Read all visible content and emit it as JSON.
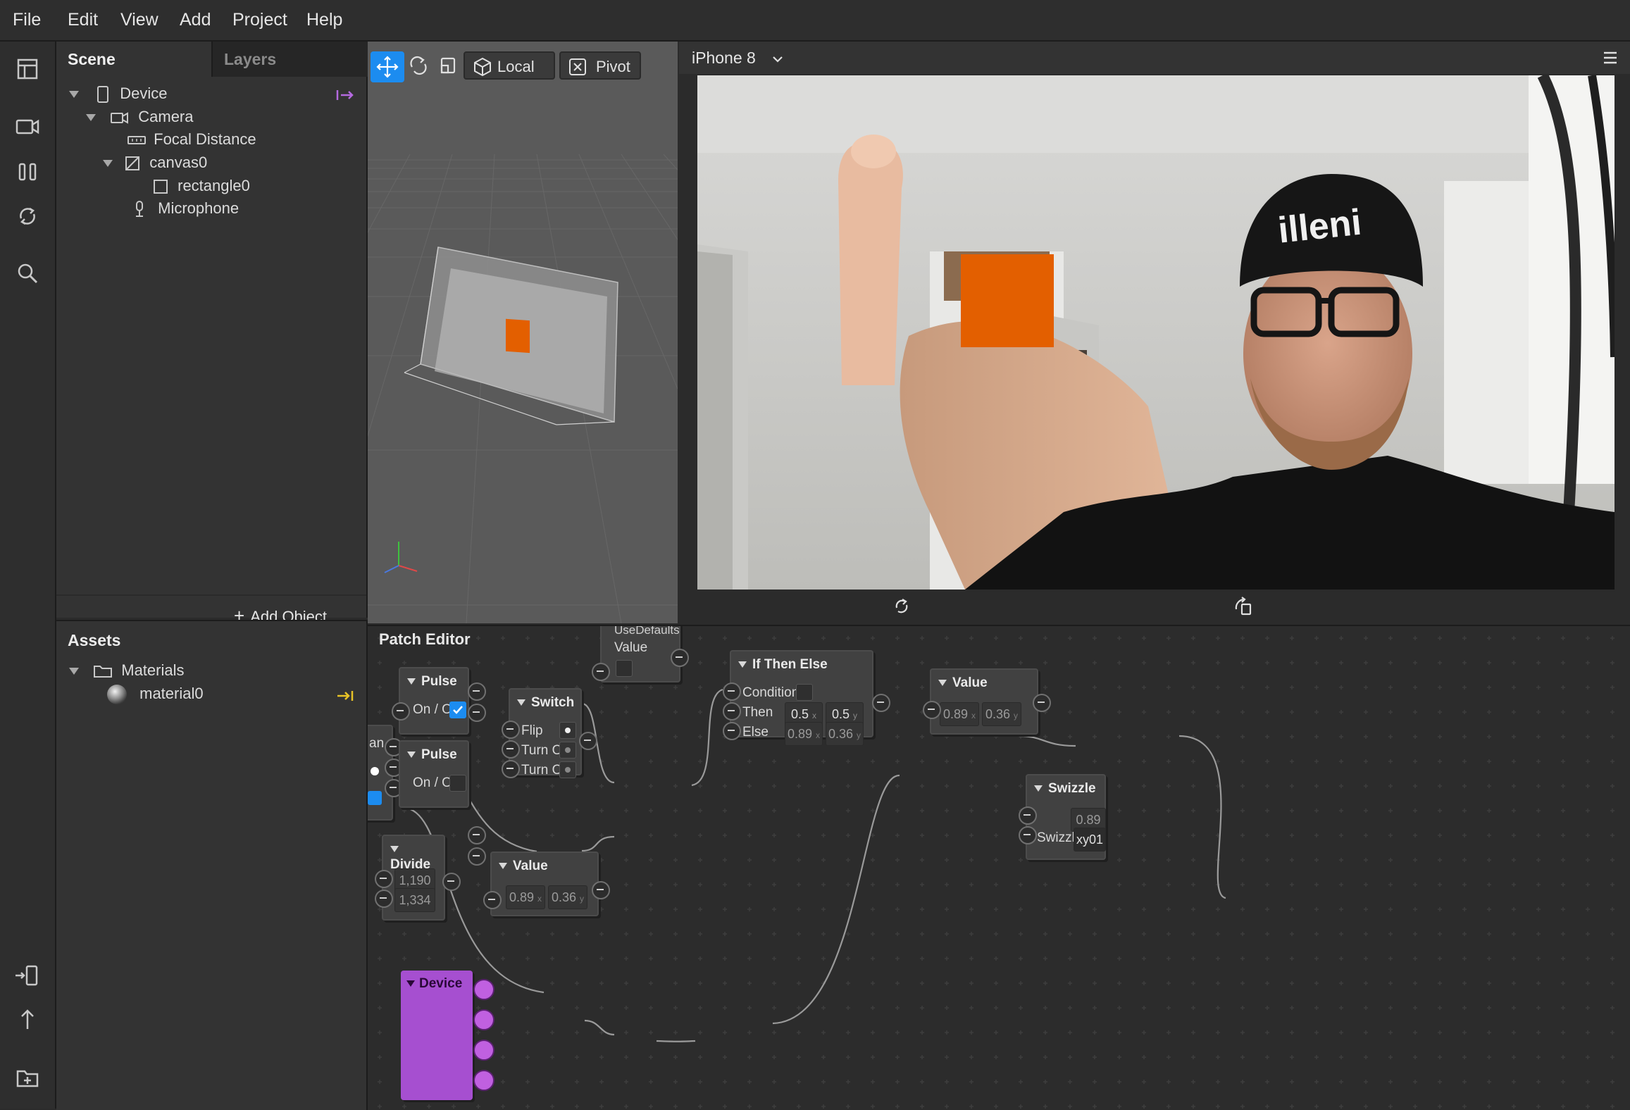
{
  "menu": {
    "items": [
      "File",
      "Edit",
      "View",
      "Add",
      "Project",
      "Help"
    ]
  },
  "scene": {
    "tabs": {
      "scene": "Scene",
      "layers": "Layers"
    },
    "tree": {
      "device": "Device",
      "camera": "Camera",
      "focal_distance": "Focal Distance",
      "canvas": "canvas0",
      "rectangle": "rectangle0",
      "microphone": "Microphone"
    },
    "add_object": "Add Object"
  },
  "assets": {
    "title": "Assets",
    "materials": "Materials",
    "material": "material0"
  },
  "viewport": {
    "buttons": {
      "local": "Local",
      "pivot": "Pivot"
    }
  },
  "simulator": {
    "device_selector": "iPhone 8",
    "overlay_color": "#e35f00"
  },
  "patch_editor": {
    "title": "Patch Editor",
    "partial_node_label": "an",
    "use_defaults": {
      "label": "UseDefaults",
      "value_label": "Value"
    },
    "pulse1": {
      "title": "Pulse",
      "onoff": "On / Off",
      "checked": true
    },
    "pulse2": {
      "title": "Pulse",
      "onoff": "On / Off",
      "checked": false
    },
    "switch": {
      "title": "Switch",
      "flip": "Flip",
      "turn_on": "Turn On",
      "turn_off": "Turn Off"
    },
    "ifthenelse": {
      "title": "If Then Else",
      "condition": "Condition",
      "then": "Then",
      "else": "Else",
      "then_x": "0.5",
      "then_y": "0.5",
      "else_x": "0.89",
      "else_y": "0.36",
      "axis_x": "x",
      "axis_y": "y"
    },
    "value_right": {
      "title": "Value",
      "x": "0.89",
      "y": "0.36"
    },
    "swizzle": {
      "title": "Swizzle",
      "value": "0.89",
      "label": "Swizzle",
      "field": "xy01"
    },
    "divide": {
      "title": "Divide",
      "a": "1,190",
      "b": "1,334"
    },
    "value_bottom": {
      "title": "Value",
      "x": "0.89",
      "y": "0.36"
    },
    "device": {
      "title": "Device",
      "color": "#a64fd0"
    }
  }
}
